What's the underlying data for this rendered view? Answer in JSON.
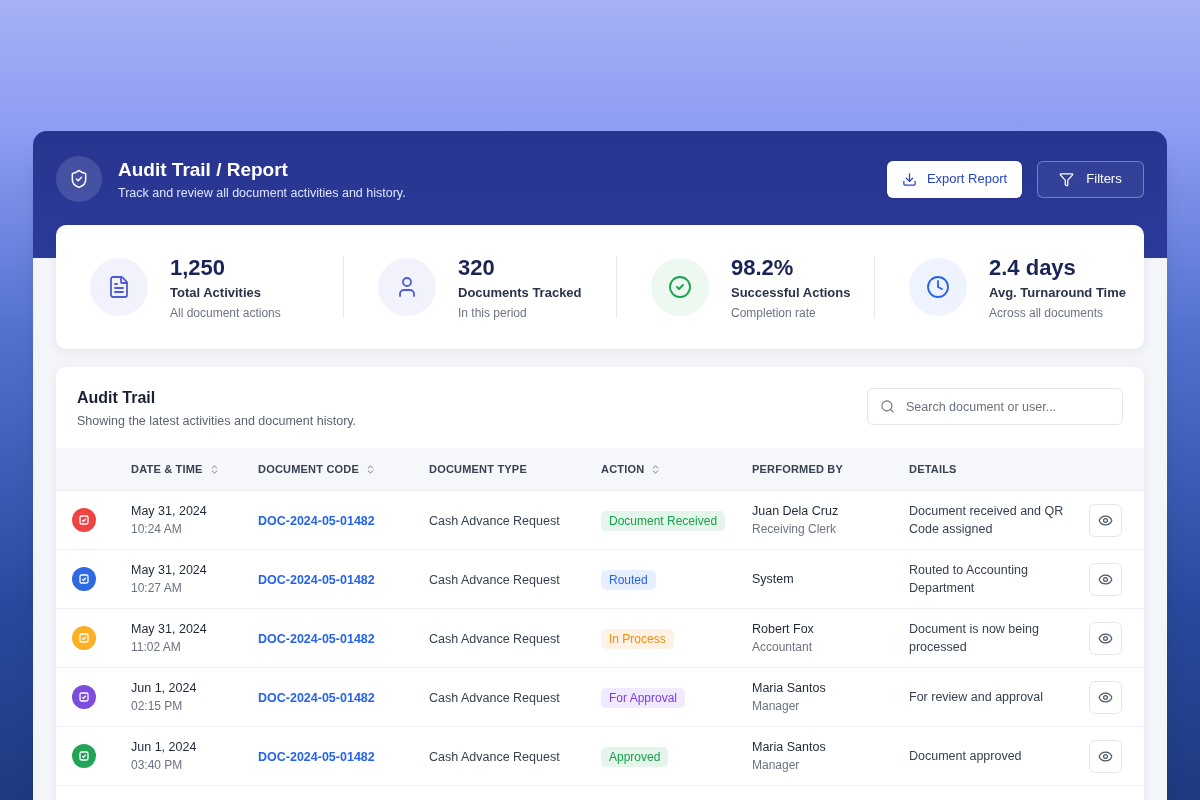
{
  "header": {
    "title": "Audit Trail / Report",
    "subtitle": "Track and review all document activities and history.",
    "buttons": [
      {
        "label": "Export Report",
        "kind": "primary"
      },
      {
        "label": "Filters",
        "kind": "outline"
      }
    ]
  },
  "stats": [
    {
      "value": "1,250",
      "label": "Total Activities",
      "caption": "All document actions",
      "color": "#4f5bd5"
    },
    {
      "value": "320",
      "label": "Documents Tracked",
      "caption": "In this period",
      "color": "#4f5bd5"
    },
    {
      "value": "98.2%",
      "label": "Successful Actions",
      "caption": "Completion rate",
      "color": "#16a34a"
    },
    {
      "value": "2.4 days",
      "label": "Avg. Turnaround Time",
      "caption": "Across all documents",
      "color": "#2563eb"
    }
  ],
  "audit_trail": {
    "title": "Audit Trail",
    "subtitle": "Showing the latest activities and document history.",
    "search": {
      "placeholder": "Search document or user..."
    },
    "columns": [
      {
        "label": "DATE & TIME",
        "sortable": true
      },
      {
        "label": "DOCUMENT CODE",
        "sortable": true
      },
      {
        "label": "DOCUMENT TYPE",
        "sortable": false
      },
      {
        "label": "ACTION",
        "sortable": true
      },
      {
        "label": "PERFORMED BY",
        "sortable": false
      },
      {
        "label": "DETAILS",
        "sortable": false
      }
    ],
    "rows": [
      {
        "color": "#ef4444",
        "date": "May 31, 2024",
        "time": "10:24 AM",
        "code": "DOC-2024-05-01482",
        "type": "Cash Advance Request",
        "action": {
          "label": "Document Received",
          "color": "#16a34a"
        },
        "performer": "Juan Dela Cruz",
        "role": "Receiving Clerk",
        "details": "Document received and QR Code assigned"
      },
      {
        "color": "#2f6be0",
        "date": "May 31, 2024",
        "time": "10:27 AM",
        "code": "DOC-2024-05-01482",
        "type": "Cash Advance Request",
        "action": {
          "label": "Routed",
          "color": "#2563eb"
        },
        "performer": "System",
        "details": "Routed to Accounting Department"
      },
      {
        "color": "#fbb023",
        "date": "May 31, 2024",
        "time": "11:02 AM",
        "code": "DOC-2024-05-01482",
        "type": "Cash Advance Request",
        "action": {
          "label": "In Process",
          "color": "#f08c0a"
        },
        "performer": "Robert Fox",
        "role": "Accountant",
        "details": "Document is now being processed"
      },
      {
        "color": "#7c4ddb",
        "date": "Jun 1, 2024",
        "time": "02:15 PM",
        "code": "DOC-2024-05-01482",
        "type": "Cash Advance Request",
        "action": {
          "label": "For Approval",
          "color": "#7c3aed"
        },
        "performer": "Maria Santos",
        "role": "Manager",
        "details": "For review and approval"
      },
      {
        "color": "#22a355",
        "date": "Jun 1, 2024",
        "time": "03:40 PM",
        "code": "DOC-2024-05-01482",
        "type": "Cash Advance Request",
        "action": {
          "label": "Approved",
          "color": "#16a34a"
        },
        "performer": "Maria Santos",
        "role": "Manager",
        "details": "Document approved"
      }
    ]
  }
}
